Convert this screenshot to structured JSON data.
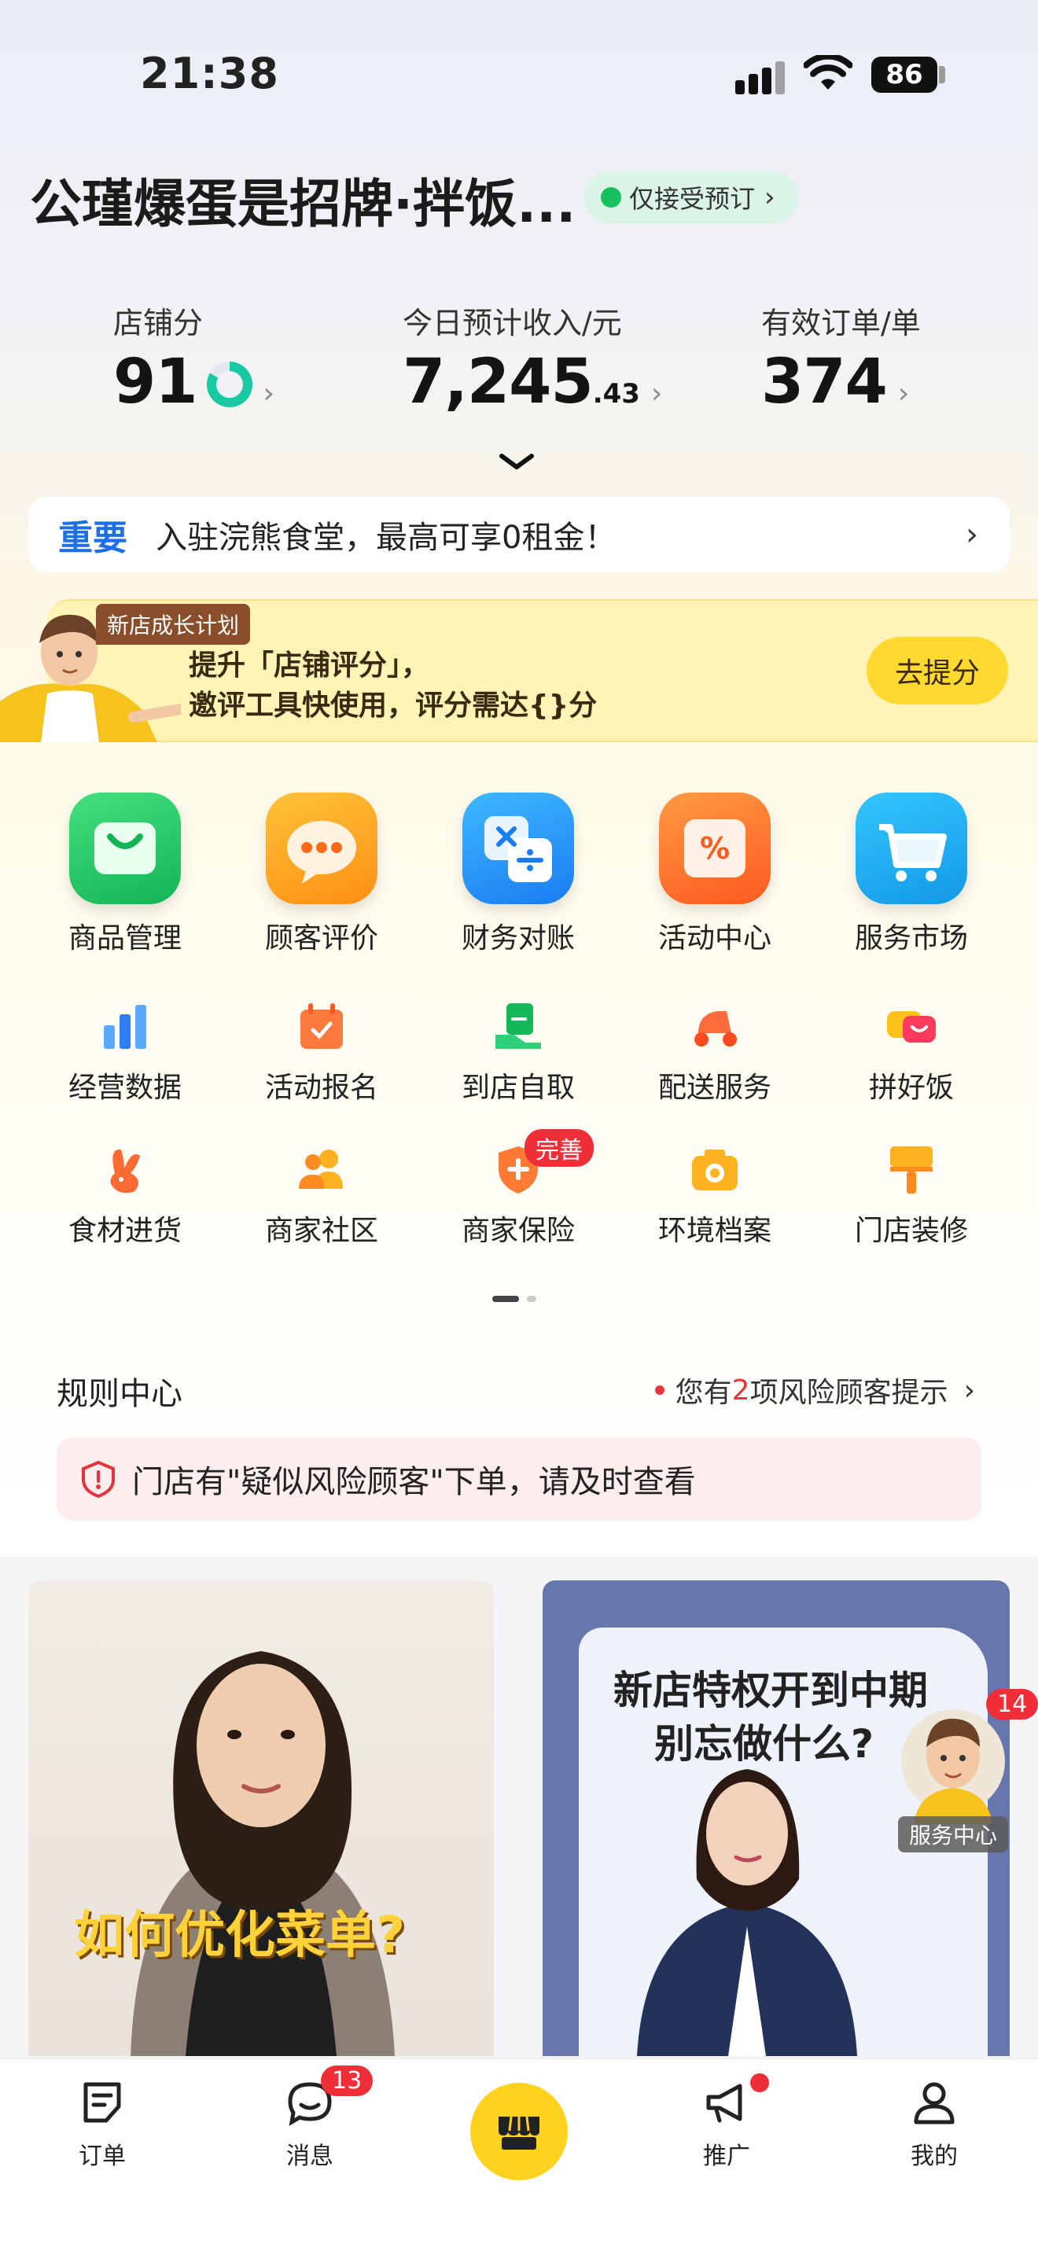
{
  "status_bar": {
    "time": "21:38",
    "battery": "86"
  },
  "header": {
    "store_name": "公瑾爆蛋是招牌·拌饭...",
    "order_mode": "仅接受预订"
  },
  "metrics": {
    "score": {
      "label": "店铺分",
      "value": "91"
    },
    "income": {
      "label": "今日预计收入/元",
      "value": "7,245",
      "decimal": ".43"
    },
    "orders": {
      "label": "有效订单/单",
      "value": "374"
    }
  },
  "notice": {
    "tag": "重要",
    "text": "入驻浣熊食堂，最高可享0租金！"
  },
  "growth": {
    "badge": "新店成长计划",
    "line1": "提升「店铺评分」，",
    "line2": "邀评工具快使用，评分需达{}分",
    "button": "去提分"
  },
  "tools": {
    "row1": [
      "商品管理",
      "顾客评价",
      "财务对账",
      "活动中心",
      "服务市场"
    ],
    "row2": [
      "经营数据",
      "活动报名",
      "到店自取",
      "配送服务",
      "拼好饭"
    ],
    "row3": [
      "食材进货",
      "商家社区",
      "商家保险",
      "环境档案",
      "门店装修"
    ],
    "insurance_badge": "完善"
  },
  "rules": {
    "title": "规则中心",
    "tip_prefix": "您有",
    "tip_count": "2",
    "tip_suffix": "项风险顾客提示",
    "alert": "门店有\"疑似风险顾客\"下单，请及时查看"
  },
  "cards": {
    "left_caption": "如何优化菜单?",
    "right_line1": "新店特权开到中期",
    "right_line2": "别忘做什么?"
  },
  "service_center": {
    "label": "服务中心",
    "badge": "14"
  },
  "tabbar": {
    "orders": "订单",
    "messages": "消息",
    "messages_badge": "13",
    "promote": "推广",
    "mine": "我的"
  },
  "colors": {
    "accent_blue": "#1e6fe6",
    "brand_yellow": "#ffd21f",
    "alert_red": "#e5343b",
    "status_green": "#16c25e"
  }
}
